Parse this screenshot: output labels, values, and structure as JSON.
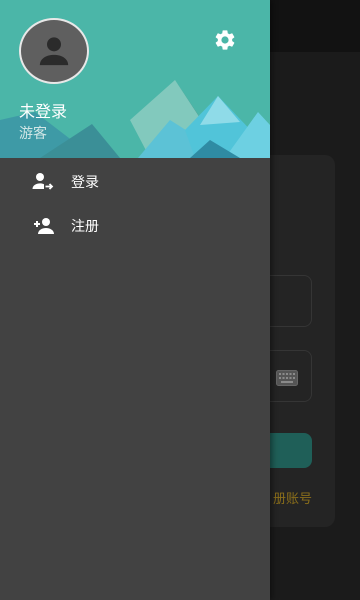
{
  "drawer": {
    "user": {
      "name": "未登录",
      "role": "游客",
      "avatar_icon": "person-icon"
    },
    "settings_icon": "gear-icon",
    "menu": [
      {
        "label": "登录",
        "icon": "login-user-icon"
      },
      {
        "label": "注册",
        "icon": "add-user-icon"
      }
    ]
  },
  "background": {
    "register_link": "册账号"
  },
  "colors": {
    "header_teal": "#4bb6a8",
    "drawer_bg": "#424242",
    "accent_teal": "#1f5f58",
    "link_gold": "#8a6e1a"
  }
}
